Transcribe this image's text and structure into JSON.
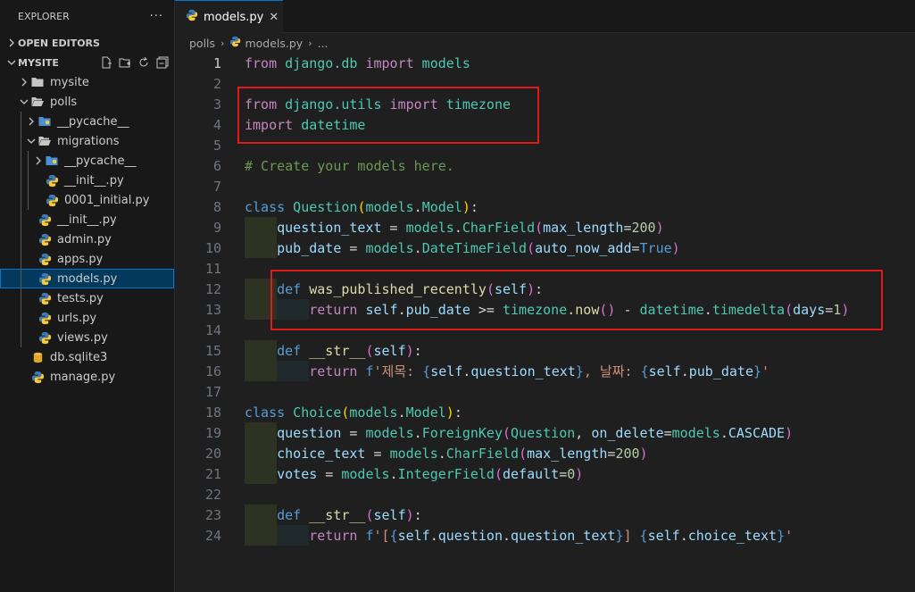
{
  "sidebar": {
    "title": "EXPLORER",
    "more": "···",
    "open_editors": "OPEN EDITORS",
    "project": "MYSITE",
    "tree": [
      {
        "label": "mysite",
        "kind": "folder",
        "depth": 0,
        "chev": "›"
      },
      {
        "label": "polls",
        "kind": "folder-open",
        "depth": 0,
        "chev": "⌄"
      },
      {
        "label": "__pycache__",
        "kind": "folder-blue",
        "depth": 1,
        "chev": "›"
      },
      {
        "label": "migrations",
        "kind": "folder-open",
        "depth": 1,
        "chev": "⌄"
      },
      {
        "label": "__pycache__",
        "kind": "folder-blue",
        "depth": 2,
        "chev": "›"
      },
      {
        "label": "__init__.py",
        "kind": "py",
        "depth": 2,
        "chev": ""
      },
      {
        "label": "0001_initial.py",
        "kind": "py",
        "depth": 2,
        "chev": ""
      },
      {
        "label": "__init__.py",
        "kind": "py",
        "depth": 1,
        "chev": ""
      },
      {
        "label": "admin.py",
        "kind": "py",
        "depth": 1,
        "chev": ""
      },
      {
        "label": "apps.py",
        "kind": "py",
        "depth": 1,
        "chev": ""
      },
      {
        "label": "models.py",
        "kind": "py",
        "depth": 1,
        "chev": "",
        "selected": true
      },
      {
        "label": "tests.py",
        "kind": "py",
        "depth": 1,
        "chev": ""
      },
      {
        "label": "urls.py",
        "kind": "py",
        "depth": 1,
        "chev": ""
      },
      {
        "label": "views.py",
        "kind": "py",
        "depth": 1,
        "chev": ""
      },
      {
        "label": "db.sqlite3",
        "kind": "db",
        "depth": 0,
        "chev": ""
      },
      {
        "label": "manage.py",
        "kind": "py",
        "depth": 0,
        "chev": ""
      }
    ]
  },
  "tab": {
    "label": "models.py",
    "close": "✕"
  },
  "breadcrumb": {
    "folder": "polls",
    "file": "models.py",
    "rest": "..."
  },
  "code": {
    "active_line": 1,
    "lines": [
      [
        [
          "kw",
          "from"
        ],
        [
          "",
          ""
        ],
        [
          "mod",
          " django.db"
        ],
        [
          "",
          ""
        ],
        [
          "kw",
          " import"
        ],
        [
          "mod",
          " models"
        ]
      ],
      [],
      [
        [
          "kw",
          "from"
        ],
        [
          "mod",
          " django.utils"
        ],
        [
          "kw",
          " import"
        ],
        [
          "mod",
          " timezone"
        ]
      ],
      [
        [
          "kw",
          "import"
        ],
        [
          "mod",
          " datetime"
        ]
      ],
      [],
      [
        [
          "cm",
          "# Create your models here."
        ]
      ],
      [],
      [
        [
          "kb",
          "class"
        ],
        [
          "mod",
          " Question"
        ],
        [
          "br1",
          "("
        ],
        [
          "mod",
          "models"
        ],
        [
          "op",
          "."
        ],
        [
          "mod",
          "Model"
        ],
        [
          "br1",
          ")"
        ],
        [
          "op",
          ":"
        ]
      ],
      [
        [
          "vr",
          "    question_text"
        ],
        [
          "op",
          " = "
        ],
        [
          "mod",
          "models"
        ],
        [
          "op",
          "."
        ],
        [
          "mod",
          "CharField"
        ],
        [
          "br2",
          "("
        ],
        [
          "vr",
          "max_length"
        ],
        [
          "op",
          "="
        ],
        [
          "nm",
          "200"
        ],
        [
          "br2",
          ")"
        ]
      ],
      [
        [
          "vr",
          "    pub_date"
        ],
        [
          "op",
          " = "
        ],
        [
          "mod",
          "models"
        ],
        [
          "op",
          "."
        ],
        [
          "mod",
          "DateTimeField"
        ],
        [
          "br2",
          "("
        ],
        [
          "vr",
          "auto_now_add"
        ],
        [
          "op",
          "="
        ],
        [
          "kb",
          "True"
        ],
        [
          "br2",
          ")"
        ]
      ],
      [],
      [
        [
          "kb",
          "    def"
        ],
        [
          "fn",
          " was_published_recently"
        ],
        [
          "br2",
          "("
        ],
        [
          "vr",
          "self"
        ],
        [
          "br2",
          ")"
        ],
        [
          "op",
          ":"
        ]
      ],
      [
        [
          "kw",
          "        return"
        ],
        [
          "vr",
          " self"
        ],
        [
          "op",
          "."
        ],
        [
          "vr",
          "pub_date"
        ],
        [
          "op",
          " >= "
        ],
        [
          "mod",
          "timezone"
        ],
        [
          "op",
          "."
        ],
        [
          "fn",
          "now"
        ],
        [
          "br2",
          "()"
        ],
        [
          "op",
          " - "
        ],
        [
          "mod",
          "datetime"
        ],
        [
          "op",
          "."
        ],
        [
          "mod",
          "timedelta"
        ],
        [
          "br2",
          "("
        ],
        [
          "vr",
          "days"
        ],
        [
          "op",
          "="
        ],
        [
          "nm",
          "1"
        ],
        [
          "br2",
          ")"
        ]
      ],
      [],
      [
        [
          "kb",
          "    def"
        ],
        [
          "fn",
          " __str__"
        ],
        [
          "br2",
          "("
        ],
        [
          "vr",
          "self"
        ],
        [
          "br2",
          ")"
        ],
        [
          "op",
          ":"
        ]
      ],
      [
        [
          "kw",
          "        return"
        ],
        [
          "kb",
          " f"
        ],
        [
          "st",
          "'제목: "
        ],
        [
          "kb",
          "{"
        ],
        [
          "vr",
          "self"
        ],
        [
          "op",
          "."
        ],
        [
          "vr",
          "question_text"
        ],
        [
          "kb",
          "}"
        ],
        [
          "st",
          ", 날짜: "
        ],
        [
          "kb",
          "{"
        ],
        [
          "vr",
          "self"
        ],
        [
          "op",
          "."
        ],
        [
          "vr",
          "pub_date"
        ],
        [
          "kb",
          "}"
        ],
        [
          "st",
          "'"
        ]
      ],
      [],
      [
        [
          "kb",
          "class"
        ],
        [
          "mod",
          " Choice"
        ],
        [
          "br1",
          "("
        ],
        [
          "mod",
          "models"
        ],
        [
          "op",
          "."
        ],
        [
          "mod",
          "Model"
        ],
        [
          "br1",
          ")"
        ],
        [
          "op",
          ":"
        ]
      ],
      [
        [
          "vr",
          "    question"
        ],
        [
          "op",
          " = "
        ],
        [
          "mod",
          "models"
        ],
        [
          "op",
          "."
        ],
        [
          "mod",
          "ForeignKey"
        ],
        [
          "br2",
          "("
        ],
        [
          "mod",
          "Question"
        ],
        [
          "op",
          ", "
        ],
        [
          "vr",
          "on_delete"
        ],
        [
          "op",
          "="
        ],
        [
          "mod",
          "models"
        ],
        [
          "op",
          "."
        ],
        [
          "vr",
          "CASCADE"
        ],
        [
          "br2",
          ")"
        ]
      ],
      [
        [
          "vr",
          "    choice_text"
        ],
        [
          "op",
          " = "
        ],
        [
          "mod",
          "models"
        ],
        [
          "op",
          "."
        ],
        [
          "mod",
          "CharField"
        ],
        [
          "br2",
          "("
        ],
        [
          "vr",
          "max_length"
        ],
        [
          "op",
          "="
        ],
        [
          "nm",
          "200"
        ],
        [
          "br2",
          ")"
        ]
      ],
      [
        [
          "vr",
          "    votes"
        ],
        [
          "op",
          " = "
        ],
        [
          "mod",
          "models"
        ],
        [
          "op",
          "."
        ],
        [
          "mod",
          "IntegerField"
        ],
        [
          "br2",
          "("
        ],
        [
          "vr",
          "default"
        ],
        [
          "op",
          "="
        ],
        [
          "nm",
          "0"
        ],
        [
          "br2",
          ")"
        ]
      ],
      [],
      [
        [
          "kb",
          "    def"
        ],
        [
          "fn",
          " __str__"
        ],
        [
          "br2",
          "("
        ],
        [
          "vr",
          "self"
        ],
        [
          "br2",
          ")"
        ],
        [
          "op",
          ":"
        ]
      ],
      [
        [
          "kw",
          "        return"
        ],
        [
          "kb",
          " f"
        ],
        [
          "st",
          "'["
        ],
        [
          "kb",
          "{"
        ],
        [
          "vr",
          "self"
        ],
        [
          "op",
          "."
        ],
        [
          "vr",
          "question"
        ],
        [
          "op",
          "."
        ],
        [
          "vr",
          "question_text"
        ],
        [
          "kb",
          "}"
        ],
        [
          "st",
          "] "
        ],
        [
          "kb",
          "{"
        ],
        [
          "vr",
          "self"
        ],
        [
          "op",
          "."
        ],
        [
          "vr",
          "choice_text"
        ],
        [
          "kb",
          "}"
        ],
        [
          "st",
          "'"
        ]
      ]
    ]
  }
}
